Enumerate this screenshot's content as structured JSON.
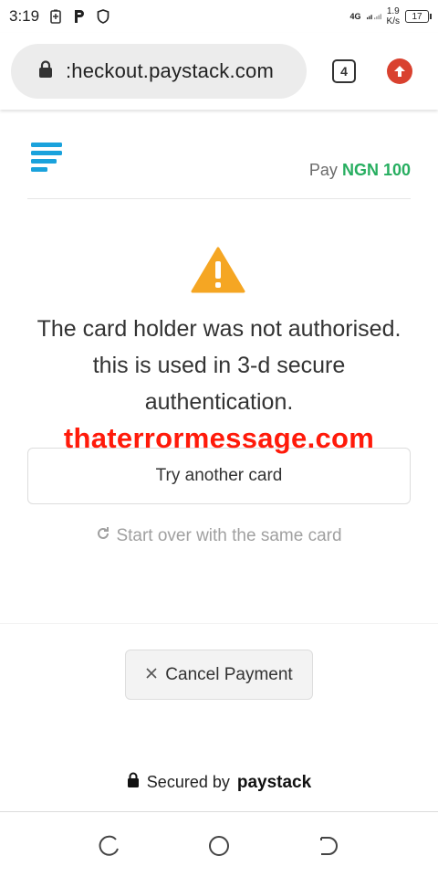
{
  "status_bar": {
    "time": "3:19",
    "network": "4G",
    "speed_value": "1.9",
    "speed_unit": "K/s",
    "battery": "17"
  },
  "browser": {
    "url": ":heckout.paystack.com",
    "tab_count": "4"
  },
  "checkout": {
    "pay_label": "Pay",
    "amount": "NGN 100"
  },
  "error": {
    "message": "The card holder was not authorised. this is used in 3-d secure authentication."
  },
  "watermark": "thaterrormessage.com",
  "actions": {
    "try_another": "Try another card",
    "start_over": "Start over with the same card",
    "cancel": "Cancel Payment"
  },
  "footer": {
    "secured_by": "Secured by",
    "brand": "paystack"
  },
  "colors": {
    "accent_green": "#27ae60",
    "warning": "#f5a623",
    "logo_blue": "#1aa2dc",
    "watermark_red": "#ff1a0a"
  }
}
